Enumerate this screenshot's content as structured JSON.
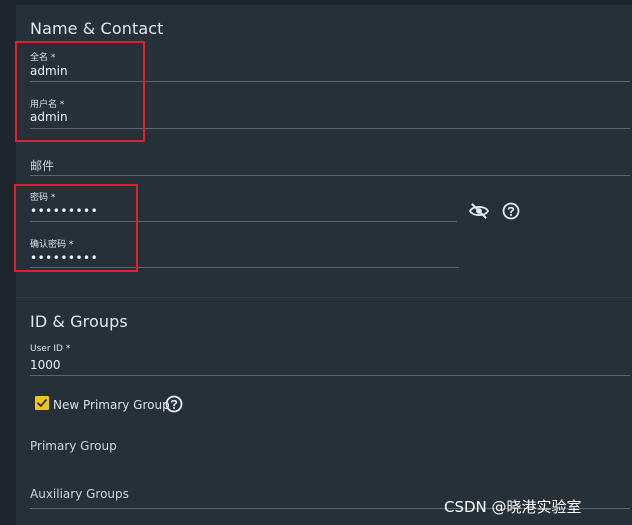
{
  "name_contact": {
    "title": "Name & Contact",
    "fullname": {
      "label": "全名 *",
      "value": "admin"
    },
    "username": {
      "label": "用户名 *",
      "value": "admin"
    },
    "email": {
      "label": "邮件"
    },
    "password": {
      "label": "密码 *",
      "value": "•••••••••"
    },
    "confirm_password": {
      "label": "确认密码 *",
      "value": "•••••••••"
    },
    "icons": {
      "visibility": "eye-off-icon",
      "help": "help-circle-icon"
    }
  },
  "id_groups": {
    "title": "ID & Groups",
    "user_id": {
      "label": "User ID *",
      "value": "1000"
    },
    "new_primary_group": {
      "label": "New Primary Group",
      "checked": true
    },
    "primary_group_label": "Primary Group",
    "auxiliary_groups_label": "Auxiliary Groups"
  },
  "watermark": "CSDN @晓港实验室",
  "colors": {
    "background": "#1e252b",
    "panel": "#263038",
    "accent_checkbox": "#f0c419",
    "highlight_box": "#e0202a"
  }
}
